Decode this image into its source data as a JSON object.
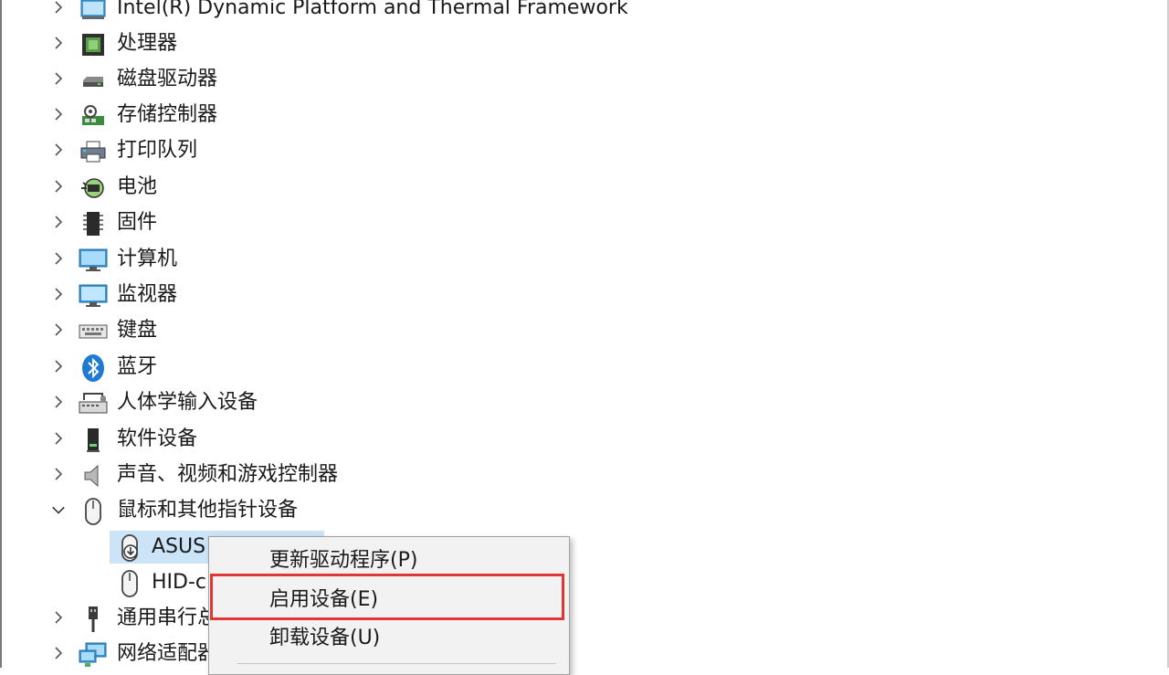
{
  "tree": {
    "items": [
      {
        "label": "Intel(R) Dynamic Platform and Thermal Framework",
        "icon": "computer-folder-icon",
        "expanded": false
      },
      {
        "label": "处理器",
        "icon": "processor-chip-icon",
        "expanded": false
      },
      {
        "label": "磁盘驱动器",
        "icon": "disk-drive-icon",
        "expanded": false
      },
      {
        "label": "存储控制器",
        "icon": "storage-controller-icon",
        "expanded": false
      },
      {
        "label": "打印队列",
        "icon": "printer-icon",
        "expanded": false
      },
      {
        "label": "电池",
        "icon": "battery-icon",
        "expanded": false
      },
      {
        "label": "固件",
        "icon": "firmware-chip-icon",
        "expanded": false
      },
      {
        "label": "计算机",
        "icon": "computer-monitor-icon",
        "expanded": false
      },
      {
        "label": "监视器",
        "icon": "monitor-icon",
        "expanded": false
      },
      {
        "label": "键盘",
        "icon": "keyboard-icon",
        "expanded": false
      },
      {
        "label": "蓝牙",
        "icon": "bluetooth-icon",
        "expanded": false
      },
      {
        "label": "人体学输入设备",
        "icon": "hid-icon",
        "expanded": false
      },
      {
        "label": "软件设备",
        "icon": "software-device-icon",
        "expanded": false
      },
      {
        "label": "声音、视频和游戏控制器",
        "icon": "speaker-icon",
        "expanded": false
      },
      {
        "label": "鼠标和其他指针设备",
        "icon": "mouse-icon",
        "expanded": true
      },
      {
        "label": "通用串行总",
        "icon": "usb-icon",
        "expanded": false
      },
      {
        "label": "网络适配器",
        "icon": "network-adapter-icon",
        "expanded": false
      }
    ],
    "children": [
      {
        "label": "ASUS",
        "icon": "disabled-mouse-icon",
        "selected": true
      },
      {
        "label": "HID-c",
        "icon": "mouse-icon",
        "selected": false
      }
    ]
  },
  "context_menu": {
    "update_driver": "更新驱动程序(P)",
    "enable_device": "启用设备(E)",
    "uninstall_device": "卸载设备(U)"
  },
  "colors": {
    "selection": "#cce4f7",
    "highlight_border": "#e23636",
    "menu_background": "#f2f2f2"
  }
}
